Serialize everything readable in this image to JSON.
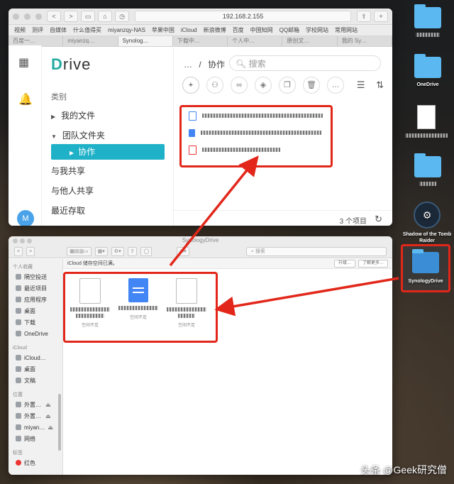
{
  "browser": {
    "url": "192.168.2.155",
    "bookmarks": [
      "视频",
      "测评",
      "自媒体",
      "什么值得买",
      "miyanzqy-NAS",
      "苹果中国",
      "iCloud",
      "新浪微博",
      "百度",
      "中国知网",
      "QQ邮箱",
      "学校网站",
      "常用网站"
    ],
    "tabs": [
      "百度一…",
      "miyanzq…",
      "Synolog…",
      "下载中…",
      "个人中…",
      "原创文…",
      "我的 Sy…"
    ]
  },
  "drive": {
    "logo": "Drive",
    "section": "类别",
    "nav": [
      "我的文件",
      "团队文件夹",
      "协作",
      "与我共享",
      "与他人共享",
      "最近存取"
    ],
    "avatar": "M",
    "breadcrumb_sep": "…",
    "breadcrumb_current": "协作",
    "search_placeholder": "搜索",
    "item_count": "3 个项目"
  },
  "finder": {
    "title": "SynologyDrive",
    "search_placeholder": "搜索",
    "icloud_notice": "iCloud 储存空间已满。",
    "upgrade": "升级…",
    "more": "了解更多…",
    "sidebar": [
      {
        "section": "个人收藏",
        "items": [
          "隔空投送",
          "最近项目",
          "应用程序",
          "桌面",
          "下载",
          "OneDrive"
        ]
      },
      {
        "section": "iCloud",
        "items": [
          "iCloud…",
          "桌面",
          "文稿"
        ]
      },
      {
        "section": "位置",
        "items": [
          "外置…",
          "外置…",
          "miyan…",
          "网络"
        ]
      },
      {
        "section": "标签",
        "items": [
          "红色"
        ]
      }
    ],
    "file_status": [
      "空间不足",
      "空间不足",
      "空间不足"
    ]
  },
  "desktop": {
    "onedrive": "OneDrive",
    "steam": "Shadow of the Tomb Raider",
    "synology": "SynologyDrive"
  },
  "watermark": "头条 @Geek研究僧",
  "colors": {
    "accent": "#1fb1c8",
    "highlight": "#e2271a",
    "logo": "#25a9a0"
  }
}
